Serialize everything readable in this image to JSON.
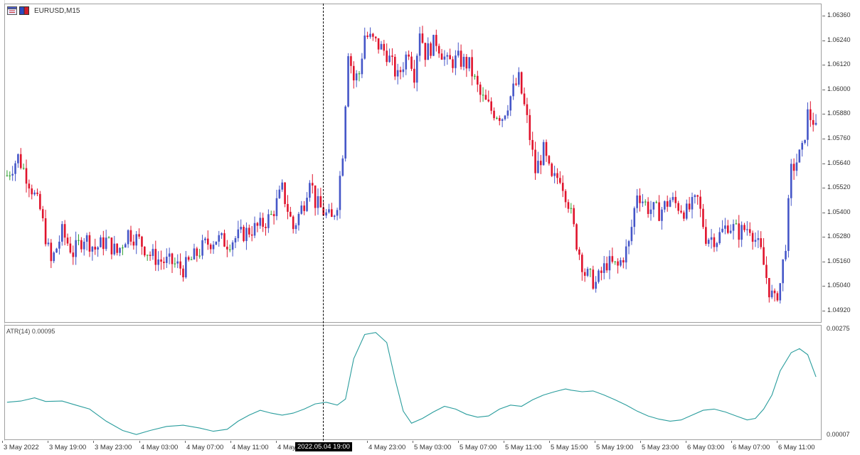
{
  "window": {
    "symbol": "EURUSD,M15"
  },
  "colors": {
    "bull": "#4556c8",
    "bear": "#e0132c",
    "doji": "#2ca02c",
    "atr_line": "#2a9d9d",
    "crosshair": "#000000",
    "grid_border": "#a0a0a0"
  },
  "price_axis": {
    "labels": [
      "1.06360",
      "1.06240",
      "1.06120",
      "1.06000",
      "1.05880",
      "1.05760",
      "1.05640",
      "1.05520",
      "1.05400",
      "1.05280",
      "1.05160",
      "1.05040",
      "1.04920"
    ],
    "values": [
      1.0636,
      1.0624,
      1.0612,
      1.06,
      1.0588,
      1.0576,
      1.0564,
      1.0552,
      1.054,
      1.0528,
      1.0516,
      1.0504,
      1.0492
    ]
  },
  "atr_axis": {
    "top_label": "0.00275",
    "bottom_label": "0.00007"
  },
  "atr_indicator": {
    "label": "ATR(14) 0.00095"
  },
  "time_axis": {
    "labels": [
      "3 May 2022",
      "3 May 19:00",
      "3 May 23:00",
      "4 May 03:00",
      "4 May 07:00",
      "4 May 11:00",
      "4 May",
      "4 May 23:00",
      "5 May 03:00",
      "5 May 07:00",
      "5 May 11:00",
      "5 May 15:00",
      "5 May 19:00",
      "5 May 23:00",
      "6 May 03:00",
      "6 May 07:00",
      "6 May 11:00"
    ]
  },
  "crosshair": {
    "time_label": "2022.05.04 19:00"
  },
  "chart_data": {
    "type": "candlestick",
    "symbol": "EURUSD",
    "timeframe": "M15",
    "ylim": [
      1.0486,
      1.0642
    ],
    "anchors": [
      {
        "bar": 0,
        "price": 1.0558
      },
      {
        "bar": 4,
        "price": 1.0567
      },
      {
        "bar": 8,
        "price": 1.0555
      },
      {
        "bar": 12,
        "price": 1.0541
      },
      {
        "bar": 16,
        "price": 1.0515
      },
      {
        "bar": 20,
        "price": 1.053
      },
      {
        "bar": 24,
        "price": 1.052
      },
      {
        "bar": 28,
        "price": 1.0528
      },
      {
        "bar": 32,
        "price": 1.0522
      },
      {
        "bar": 36,
        "price": 1.0526
      },
      {
        "bar": 40,
        "price": 1.052
      },
      {
        "bar": 44,
        "price": 1.053
      },
      {
        "bar": 48,
        "price": 1.0526
      },
      {
        "bar": 52,
        "price": 1.0519
      },
      {
        "bar": 56,
        "price": 1.0516
      },
      {
        "bar": 60,
        "price": 1.0515
      },
      {
        "bar": 64,
        "price": 1.0512
      },
      {
        "bar": 68,
        "price": 1.0518
      },
      {
        "bar": 72,
        "price": 1.0524
      },
      {
        "bar": 76,
        "price": 1.0527
      },
      {
        "bar": 80,
        "price": 1.0525
      },
      {
        "bar": 84,
        "price": 1.0528
      },
      {
        "bar": 88,
        "price": 1.0531
      },
      {
        "bar": 92,
        "price": 1.0533
      },
      {
        "bar": 96,
        "price": 1.0538
      },
      {
        "bar": 100,
        "price": 1.0551
      },
      {
        "bar": 104,
        "price": 1.0532
      },
      {
        "bar": 108,
        "price": 1.0545
      },
      {
        "bar": 110,
        "price": 1.0558
      },
      {
        "bar": 112,
        "price": 1.0545
      },
      {
        "bar": 115,
        "price": 1.054
      },
      {
        "bar": 118,
        "price": 1.0536
      },
      {
        "bar": 120,
        "price": 1.0545
      },
      {
        "bar": 122,
        "price": 1.057
      },
      {
        "bar": 123,
        "price": 1.0595
      },
      {
        "bar": 124,
        "price": 1.062
      },
      {
        "bar": 126,
        "price": 1.0605
      },
      {
        "bar": 128,
        "price": 1.0608
      },
      {
        "bar": 130,
        "price": 1.0627
      },
      {
        "bar": 134,
        "price": 1.0623
      },
      {
        "bar": 138,
        "price": 1.0618
      },
      {
        "bar": 142,
        "price": 1.0606
      },
      {
        "bar": 146,
        "price": 1.062
      },
      {
        "bar": 148,
        "price": 1.0608
      },
      {
        "bar": 150,
        "price": 1.063
      },
      {
        "bar": 152,
        "price": 1.0618
      },
      {
        "bar": 156,
        "price": 1.0624
      },
      {
        "bar": 160,
        "price": 1.0613
      },
      {
        "bar": 164,
        "price": 1.0615
      },
      {
        "bar": 168,
        "price": 1.0612
      },
      {
        "bar": 172,
        "price": 1.0597
      },
      {
        "bar": 176,
        "price": 1.059
      },
      {
        "bar": 180,
        "price": 1.0587
      },
      {
        "bar": 184,
        "price": 1.06
      },
      {
        "bar": 186,
        "price": 1.0605
      },
      {
        "bar": 189,
        "price": 1.0585
      },
      {
        "bar": 192,
        "price": 1.056
      },
      {
        "bar": 195,
        "price": 1.057
      },
      {
        "bar": 198,
        "price": 1.0555
      },
      {
        "bar": 201,
        "price": 1.0558
      },
      {
        "bar": 204,
        "price": 1.0545
      },
      {
        "bar": 207,
        "price": 1.0525
      },
      {
        "bar": 210,
        "price": 1.051
      },
      {
        "bar": 214,
        "price": 1.0505
      },
      {
        "bar": 218,
        "price": 1.0515
      },
      {
        "bar": 222,
        "price": 1.0513
      },
      {
        "bar": 226,
        "price": 1.0524
      },
      {
        "bar": 229,
        "price": 1.055
      },
      {
        "bar": 233,
        "price": 1.0542
      },
      {
        "bar": 237,
        "price": 1.054
      },
      {
        "bar": 241,
        "price": 1.0546
      },
      {
        "bar": 244,
        "price": 1.0543
      },
      {
        "bar": 247,
        "price": 1.054
      },
      {
        "bar": 251,
        "price": 1.0546
      },
      {
        "bar": 254,
        "price": 1.0528
      },
      {
        "bar": 258,
        "price": 1.0527
      },
      {
        "bar": 262,
        "price": 1.0534
      },
      {
        "bar": 266,
        "price": 1.053
      },
      {
        "bar": 270,
        "price": 1.0533
      },
      {
        "bar": 274,
        "price": 1.052
      },
      {
        "bar": 277,
        "price": 1.0502
      },
      {
        "bar": 279,
        "price": 1.0496
      },
      {
        "bar": 281,
        "price": 1.0505
      },
      {
        "bar": 283,
        "price": 1.0525
      },
      {
        "bar": 285,
        "price": 1.056
      },
      {
        "bar": 287,
        "price": 1.0565
      },
      {
        "bar": 289,
        "price": 1.057
      },
      {
        "bar": 291,
        "price": 1.0588
      },
      {
        "bar": 293,
        "price": 1.0585
      },
      {
        "bar": 294,
        "price": 1.058
      }
    ],
    "atr_series": [
      {
        "bar": 0,
        "value": 0.00092
      },
      {
        "bar": 5,
        "value": 0.00095
      },
      {
        "bar": 10,
        "value": 0.00103
      },
      {
        "bar": 14,
        "value": 0.00094
      },
      {
        "bar": 20,
        "value": 0.00095
      },
      {
        "bar": 25,
        "value": 0.00085
      },
      {
        "bar": 30,
        "value": 0.00075
      },
      {
        "bar": 36,
        "value": 0.00045
      },
      {
        "bar": 42,
        "value": 0.00022
      },
      {
        "bar": 47,
        "value": 0.00012
      },
      {
        "bar": 52,
        "value": 0.00022
      },
      {
        "bar": 58,
        "value": 0.00032
      },
      {
        "bar": 64,
        "value": 0.00035
      },
      {
        "bar": 70,
        "value": 0.00028
      },
      {
        "bar": 75,
        "value": 0.0002
      },
      {
        "bar": 80,
        "value": 0.00025
      },
      {
        "bar": 84,
        "value": 0.00045
      },
      {
        "bar": 88,
        "value": 0.0006
      },
      {
        "bar": 92,
        "value": 0.00072
      },
      {
        "bar": 96,
        "value": 0.00065
      },
      {
        "bar": 100,
        "value": 0.0006
      },
      {
        "bar": 104,
        "value": 0.00065
      },
      {
        "bar": 108,
        "value": 0.00075
      },
      {
        "bar": 112,
        "value": 0.00088
      },
      {
        "bar": 116,
        "value": 0.00092
      },
      {
        "bar": 120,
        "value": 0.00085
      },
      {
        "bar": 123,
        "value": 0.001
      },
      {
        "bar": 126,
        "value": 0.002
      },
      {
        "bar": 130,
        "value": 0.0026
      },
      {
        "bar": 134,
        "value": 0.00265
      },
      {
        "bar": 138,
        "value": 0.0024
      },
      {
        "bar": 141,
        "value": 0.0015
      },
      {
        "bar": 144,
        "value": 0.0007
      },
      {
        "bar": 147,
        "value": 0.0004
      },
      {
        "bar": 151,
        "value": 0.00052
      },
      {
        "bar": 155,
        "value": 0.00068
      },
      {
        "bar": 159,
        "value": 0.00082
      },
      {
        "bar": 163,
        "value": 0.00075
      },
      {
        "bar": 167,
        "value": 0.00062
      },
      {
        "bar": 171,
        "value": 0.00055
      },
      {
        "bar": 175,
        "value": 0.00058
      },
      {
        "bar": 179,
        "value": 0.00075
      },
      {
        "bar": 183,
        "value": 0.00085
      },
      {
        "bar": 187,
        "value": 0.00082
      },
      {
        "bar": 191,
        "value": 0.00098
      },
      {
        "bar": 195,
        "value": 0.0011
      },
      {
        "bar": 199,
        "value": 0.00118
      },
      {
        "bar": 203,
        "value": 0.00125
      },
      {
        "bar": 205,
        "value": 0.00122
      },
      {
        "bar": 209,
        "value": 0.00118
      },
      {
        "bar": 213,
        "value": 0.0012
      },
      {
        "bar": 217,
        "value": 0.0011
      },
      {
        "bar": 221,
        "value": 0.00098
      },
      {
        "bar": 225,
        "value": 0.00085
      },
      {
        "bar": 229,
        "value": 0.0007
      },
      {
        "bar": 233,
        "value": 0.00058
      },
      {
        "bar": 237,
        "value": 0.0005
      },
      {
        "bar": 241,
        "value": 0.00045
      },
      {
        "bar": 245,
        "value": 0.00048
      },
      {
        "bar": 249,
        "value": 0.0006
      },
      {
        "bar": 253,
        "value": 0.00072
      },
      {
        "bar": 257,
        "value": 0.00075
      },
      {
        "bar": 261,
        "value": 0.00068
      },
      {
        "bar": 265,
        "value": 0.00058
      },
      {
        "bar": 269,
        "value": 0.00048
      },
      {
        "bar": 272,
        "value": 0.00052
      },
      {
        "bar": 275,
        "value": 0.00075
      },
      {
        "bar": 278,
        "value": 0.0011
      },
      {
        "bar": 281,
        "value": 0.0017
      },
      {
        "bar": 285,
        "value": 0.00215
      },
      {
        "bar": 288,
        "value": 0.00225
      },
      {
        "bar": 291,
        "value": 0.0021
      },
      {
        "bar": 294,
        "value": 0.00155
      }
    ],
    "atr_ylim": [
      7e-05,
      0.00275
    ]
  }
}
